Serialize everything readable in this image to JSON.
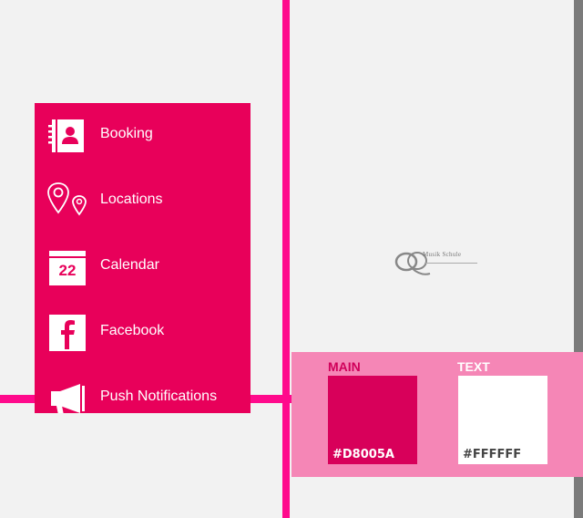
{
  "menu": {
    "items": [
      {
        "label": "Booking",
        "icon": "contacts-book-icon"
      },
      {
        "label": "Locations",
        "icon": "map-pin-icon"
      },
      {
        "label": "Calendar",
        "icon": "calendar-icon",
        "day": "22"
      },
      {
        "label": "Facebook",
        "icon": "facebook-icon"
      },
      {
        "label": "Push Notifications",
        "icon": "megaphone-icon"
      }
    ]
  },
  "logo": {
    "text": "Musik Schule"
  },
  "palette": {
    "main": {
      "title": "MAIN",
      "hex": "#D8005A",
      "color": "#D8005A"
    },
    "text": {
      "title": "TEXT",
      "hex": "#FFFFFF",
      "color": "#FFFFFF"
    }
  },
  "colors": {
    "menu_background": "#e8005a",
    "divider": "#ff0a8c",
    "palette_background": "#f586b6",
    "title_color": "#d0005a"
  }
}
